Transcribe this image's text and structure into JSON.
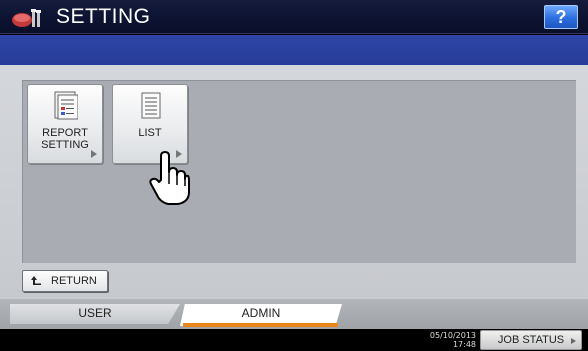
{
  "header": {
    "title": "SETTING",
    "icon": "setting-tools-icon",
    "help_label": "?"
  },
  "functions": [
    {
      "label": "REPORT\nSETTING",
      "icon": "report-setting-icon"
    },
    {
      "label": "LIST",
      "icon": "list-icon"
    }
  ],
  "return_label": "RETURN",
  "tabs": [
    {
      "label": "USER",
      "selected": false
    },
    {
      "label": "ADMIN",
      "selected": true
    }
  ],
  "status": {
    "date": "05/10/2013",
    "time": "17:48",
    "job_status_label": "JOB STATUS"
  },
  "colors": {
    "title_bar": "#0c1230",
    "blue_bar": "#2b41a0",
    "active_tab_underline": "#e9871c",
    "help_button": "#2d6fe0"
  }
}
